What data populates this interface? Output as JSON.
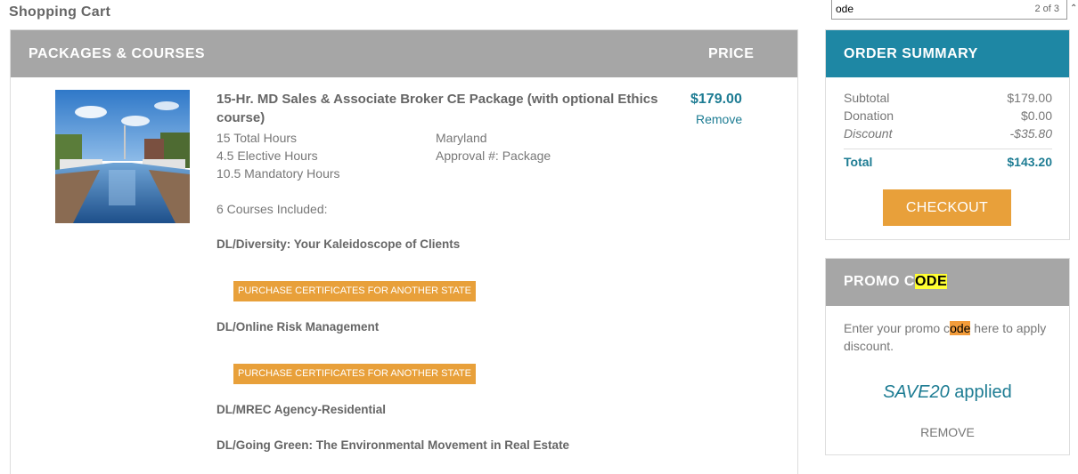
{
  "page": {
    "title": "Shopping Cart"
  },
  "find_bar": {
    "query": "ode",
    "match_count": "2 of 3"
  },
  "cart": {
    "header": {
      "packages_label": "PACKAGES & COURSES",
      "price_label": "PRICE"
    },
    "item": {
      "title": "15-Hr. MD Sales & Associate Broker CE Package (with optional Ethics course)",
      "total_hours": "15 Total Hours",
      "elective_hours": "4.5 Elective Hours",
      "mandatory_hours": "10.5 Mandatory Hours",
      "state": "Maryland",
      "approval": "Approval #: Package",
      "courses_included": "6 Courses Included:",
      "price": "$179.00",
      "remove_label": "Remove",
      "courses": [
        {
          "name": "DL/Diversity: Your Kaleidoscope of Clients",
          "cert_button": "PURCHASE CERTIFICATES FOR ANOTHER STATE"
        },
        {
          "name": "DL/Online Risk Management",
          "cert_button": "PURCHASE CERTIFICATES FOR ANOTHER STATE"
        },
        {
          "name": "DL/MREC Agency-Residential"
        },
        {
          "name": "DL/Going Green: The Environmental Movement in Real Estate"
        }
      ]
    }
  },
  "summary": {
    "title": "ORDER SUMMARY",
    "subtotal_label": "Subtotal",
    "subtotal_value": "$179.00",
    "donation_label": "Donation",
    "donation_value": "$0.00",
    "discount_label": "Discount",
    "discount_value": "-$35.80",
    "total_label": "Total",
    "total_value": "$143.20",
    "checkout_label": "CHECKOUT"
  },
  "promo": {
    "title_prefix": "PROMO C",
    "title_highlight": "ODE",
    "desc_prefix": "Enter your promo c",
    "desc_highlight": "ode",
    "desc_suffix": " here to apply discount.",
    "applied_code": "SAVE20",
    "applied_suffix": " applied",
    "remove_label": "REMOVE"
  },
  "colors": {
    "accent": "#1e87a4",
    "button": "#e8a03a",
    "header_gray": "#a6a6a6",
    "find_highlight": "#ffff33",
    "find_current": "#f39c3a"
  }
}
